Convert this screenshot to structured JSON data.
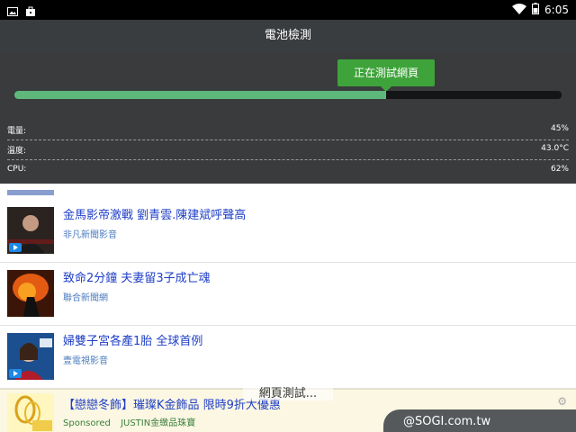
{
  "status_bar": {
    "time": "6:05",
    "left_icons": [
      "image-icon",
      "bag-icon"
    ],
    "right_icons": [
      "wifi-icon",
      "battery-icon"
    ]
  },
  "header": {
    "title": "電池檢測"
  },
  "test_panel": {
    "stage_label": "正在測試網頁",
    "progress_percent": 68,
    "stats": [
      {
        "label": "電量:",
        "value": "45%"
      },
      {
        "label": "溫度:",
        "value": "43.0°C"
      },
      {
        "label": "CPU:",
        "value": "62%"
      }
    ],
    "colors": {
      "panel": "#242628",
      "progress": "#5fb87b",
      "badge": "#3ea33a"
    }
  },
  "news": {
    "items": [
      {
        "title": "金馬影帝激戰 劉青雲.陳建斌呼聲高",
        "source": "非凡新聞影音"
      },
      {
        "title": "致命2分鐘 夫妻留3子成亡魂",
        "source": "聯合新聞網"
      },
      {
        "title": "婦雙子宮各產1胎 全球首例",
        "source": "壹電視影音"
      }
    ],
    "ad": {
      "title": "【戀戀冬飾】璀璨K金飾品 限時9折大優惠",
      "sponsored": "Sponsored",
      "advertiser": "JUSTIN金緻品珠寶",
      "thumb_text": "現金"
    }
  },
  "toast": {
    "text": "網頁測試..."
  },
  "watermark": {
    "text": "@SOGI.com.tw"
  }
}
